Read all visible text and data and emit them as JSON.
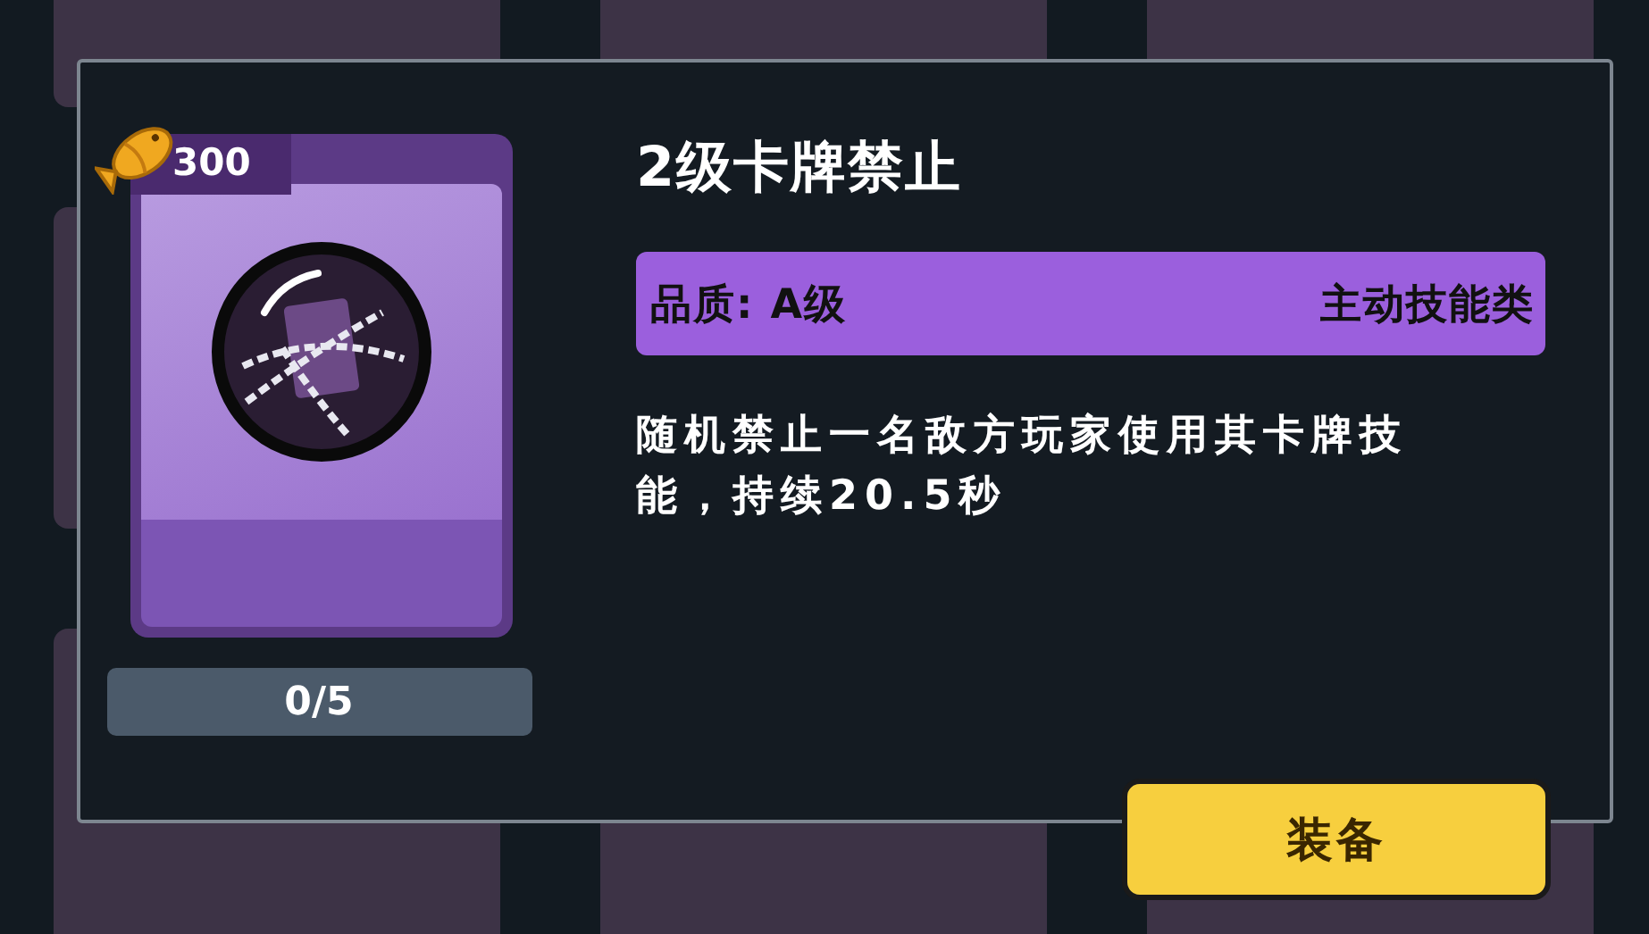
{
  "card": {
    "cost": "300",
    "progress": "0/5"
  },
  "skill": {
    "title": "2级卡牌禁止",
    "quality": "品质: A级",
    "category": "主动技能类",
    "description": "随机禁止一名敌方玩家使用其卡牌技能，持续20.5秒"
  },
  "buttons": [
    {
      "label": "装备"
    }
  ]
}
